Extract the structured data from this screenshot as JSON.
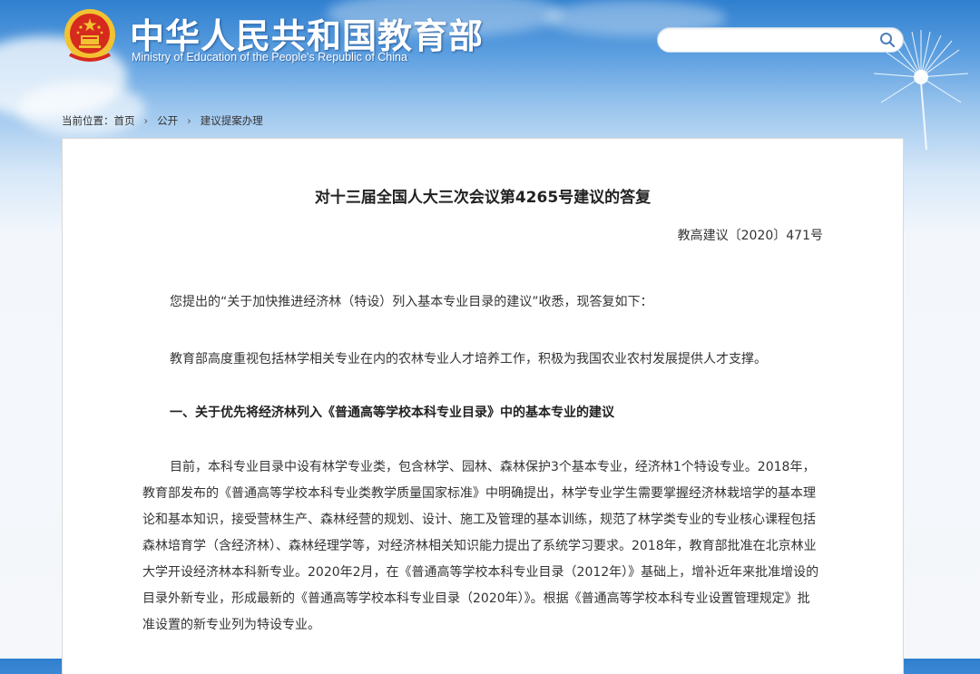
{
  "header": {
    "site_name_cn": "中华人民共和国教育部",
    "site_name_en": "Ministry of Education of the People's Republic of China",
    "search": {
      "placeholder": "",
      "value": ""
    },
    "icons": [
      "national-emblem-icon",
      "search-icon",
      "dandelion-decoration"
    ]
  },
  "breadcrumb": {
    "prefix": "当前位置：",
    "items": [
      "首页",
      "公开",
      "建议提案办理"
    ],
    "separator": "›"
  },
  "document": {
    "title": "对十三届全国人大三次会议第4265号建议的答复",
    "number": "教高建议〔2020〕471号",
    "paragraphs": [
      "您提出的“关于加快推进经济林（特设）列入基本专业目录的建议”收悉，现答复如下：",
      "教育部高度重视包括林学相关专业在内的农林专业人才培养工作，积极为我国农业农村发展提供人才支撑。",
      "一、关于优先将经济林列入《普通高等学校本科专业目录》中的基本专业的建议",
      "目前，本科专业目录中设有林学专业类，包含林学、园林、森林保护3个基本专业，经济林1个特设专业。2018年，教育部发布的《普通高等学校本科专业类教学质量国家标准》中明确提出，林学专业学生需要掌握经济林栽培学的基本理论和基本知识，接受营林生产、森林经营的规划、设计、施工及管理的基本训练，规范了林学类专业的专业核心课程包括森林培育学（含经济林）、森林经理学等，对经济林相关知识能力提出了系统学习要求。2018年，教育部批准在北京林业大学开设经济林本科新专业。2020年2月，在《普通高等学校本科专业目录（2012年）》基础上，增补近年来批准增设的目录外新专业，形成最新的《普通高等学校本科专业目录（2020年）》。根据《普通高等学校本科专业设置管理规定》批准设置的新专业列为特设专业。"
    ]
  },
  "colors": {
    "sky_top": "#2f7fcf",
    "emblem_red": "#d62a1e",
    "emblem_gold": "#f2c230",
    "text": "#333333"
  }
}
